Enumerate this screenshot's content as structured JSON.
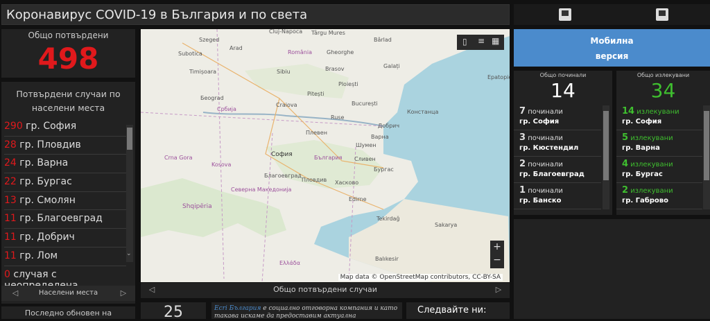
{
  "header": {
    "title": "Коронавирус COVID-19 в България и по света"
  },
  "total_confirmed": {
    "label": "Общо потвърдени",
    "value": "498"
  },
  "by_city": {
    "title_line1": "Потвърдени случаи по",
    "title_line2": "населени места",
    "rows": [
      {
        "count": "290",
        "place": " гр. София"
      },
      {
        "count": "28",
        "place": " гр. Пловдив"
      },
      {
        "count": "24",
        "place": " гр. Варна"
      },
      {
        "count": "22",
        "place": " гр. Бургас"
      },
      {
        "count": "13",
        "place": " гр. Смолян"
      },
      {
        "count": "11",
        "place": " гр. Благоевград"
      },
      {
        "count": "11",
        "place": " гр. Добрич"
      },
      {
        "count": "11",
        "place": " гр. Лом"
      },
      {
        "count": "0",
        "place": " случая с неопределена"
      }
    ],
    "footer_label": "Населени места"
  },
  "map": {
    "footer_label": "Общо потвърдени случаи",
    "attribution": "Map data © OpenStreetMap contributors, CC-BY-SA",
    "zoom_in": "+",
    "zoom_out": "−",
    "places": [
      {
        "name": "Cluj-Napoca"
      },
      {
        "name": "Târgu Mures"
      },
      {
        "name": "Bârlad"
      },
      {
        "name": "Szeged"
      },
      {
        "name": "Arad"
      },
      {
        "name": "Brasov"
      },
      {
        "name": "Galați"
      },
      {
        "name": "Ploiești"
      },
      {
        "name": "Craiova"
      },
      {
        "name": "Бeograd"
      },
      {
        "name": "Србија"
      },
      {
        "name": "Pitești"
      },
      {
        "name": "București"
      },
      {
        "name": "Констанца"
      },
      {
        "name": "Плевен"
      },
      {
        "name": "Варна"
      },
      {
        "name": "София"
      },
      {
        "name": "България"
      },
      {
        "name": "Бургас"
      },
      {
        "name": "Пловдив"
      },
      {
        "name": "Хасково"
      },
      {
        "name": "Kosova"
      },
      {
        "name": "Северна Македонија"
      },
      {
        "name": "Shqipëria"
      },
      {
        "name": "Edirne"
      },
      {
        "name": "Tekirdağ"
      },
      {
        "name": "Sakarya"
      },
      {
        "name": "Balıkesir"
      },
      {
        "name": "Ελλάδα"
      },
      {
        "name": "Шумен"
      },
      {
        "name": "Добрич"
      },
      {
        "name": "Сливен"
      },
      {
        "name": "Благоевград"
      },
      {
        "name": "Crna Gora"
      },
      {
        "name": "Eрatopie"
      },
      {
        "name": "Subotica"
      },
      {
        "name": "Timișoara"
      },
      {
        "name": "România"
      },
      {
        "name": "Ruse"
      },
      {
        "name": "Gheorghe"
      },
      {
        "name": "Sibiu"
      }
    ]
  },
  "toolbar": {
    "icon1": "image-icon",
    "icon2": "image-icon"
  },
  "mobile": {
    "line1": "Мобилна",
    "line2": "версия"
  },
  "deaths": {
    "label": "Общо починали",
    "value": "14",
    "rows": [
      {
        "n": "7",
        "word": " починали",
        "city": "гр. София"
      },
      {
        "n": "3",
        "word": " починали",
        "city": "гр. Кюстендил"
      },
      {
        "n": "2",
        "word": " починали",
        "city": "гр. Благоевград"
      },
      {
        "n": "1",
        "word": " починали",
        "city": "гр. Банско"
      }
    ]
  },
  "recovered": {
    "label": "Общо излекувани",
    "value": "34",
    "rows": [
      {
        "n": "14",
        "word": " излекувани",
        "city": "гр. София"
      },
      {
        "n": "5",
        "word": " излекувани",
        "city": "гр. Варна"
      },
      {
        "n": "4",
        "word": " излекувани",
        "city": "гр. Бургас"
      },
      {
        "n": "2",
        "word": " излекувани",
        "city": "гр. Габрово"
      }
    ]
  },
  "bottom": {
    "updated_label": "Последно обновен на",
    "days_value": "25",
    "info_link": "Ecri България",
    "info_text": " е социално отговорна компания и като такава искаме да предоставим актуална информация",
    "follow_label": "Следвайте ни:"
  },
  "colors": {
    "red": "#e0191c",
    "green": "#3fbf2f",
    "blue": "#4b8bcc"
  }
}
